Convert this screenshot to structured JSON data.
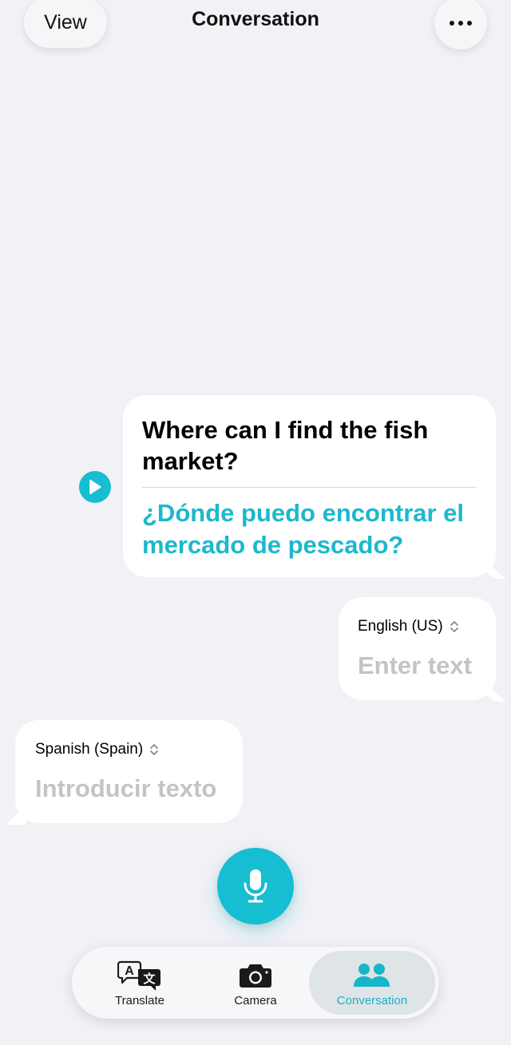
{
  "header": {
    "view_label": "View",
    "title": "Conversation",
    "more_icon": "ellipsis-icon"
  },
  "conversation": {
    "source_text": "Where can I find the fish market?",
    "translated_text": "¿Dónde puedo encontrar el mercado de pescado?",
    "play_icon": "play-icon"
  },
  "inputs": {
    "english": {
      "language": "English (US)",
      "placeholder": "Enter text"
    },
    "spanish": {
      "language": "Spanish (Spain)",
      "placeholder": "Introducir texto"
    }
  },
  "mic_icon": "microphone-icon",
  "tabs": [
    {
      "label": "Translate",
      "icon": "translate-icon",
      "active": false
    },
    {
      "label": "Camera",
      "icon": "camera-icon",
      "active": false
    },
    {
      "label": "Conversation",
      "icon": "people-icon",
      "active": true
    }
  ],
  "colors": {
    "accent": "#17bdd0",
    "translated_text": "#1cb8cc",
    "background": "#f1f1f6",
    "placeholder": "#c4c4c8"
  }
}
